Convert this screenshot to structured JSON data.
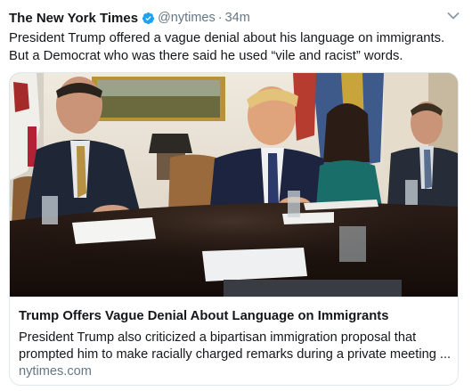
{
  "tweet": {
    "author_name": "The New York Times",
    "verified_icon": "verified-badge-icon",
    "handle": "@nytimes",
    "separator": "·",
    "timestamp": "34m",
    "text": "President Trump offered a vague denial about his language on immigrants. But a Democrat who was there said he used “vile and racist” words."
  },
  "card": {
    "image_alt": "meeting-at-white-house-table-photo",
    "title": "Trump Offers Vague Denial About Language on Immigrants",
    "description": "President Trump also criticized a bipartisan immigration proposal that prompted him to make racially charged remarks during a private meeting ...",
    "domain": "nytimes.com"
  },
  "icons": {
    "verified": "verified-badge-icon",
    "menu": "chevron-down-icon"
  },
  "colors": {
    "text_primary": "#14171a",
    "text_secondary": "#657786",
    "verified_blue": "#1da1f2",
    "border": "#e1e8ed"
  }
}
